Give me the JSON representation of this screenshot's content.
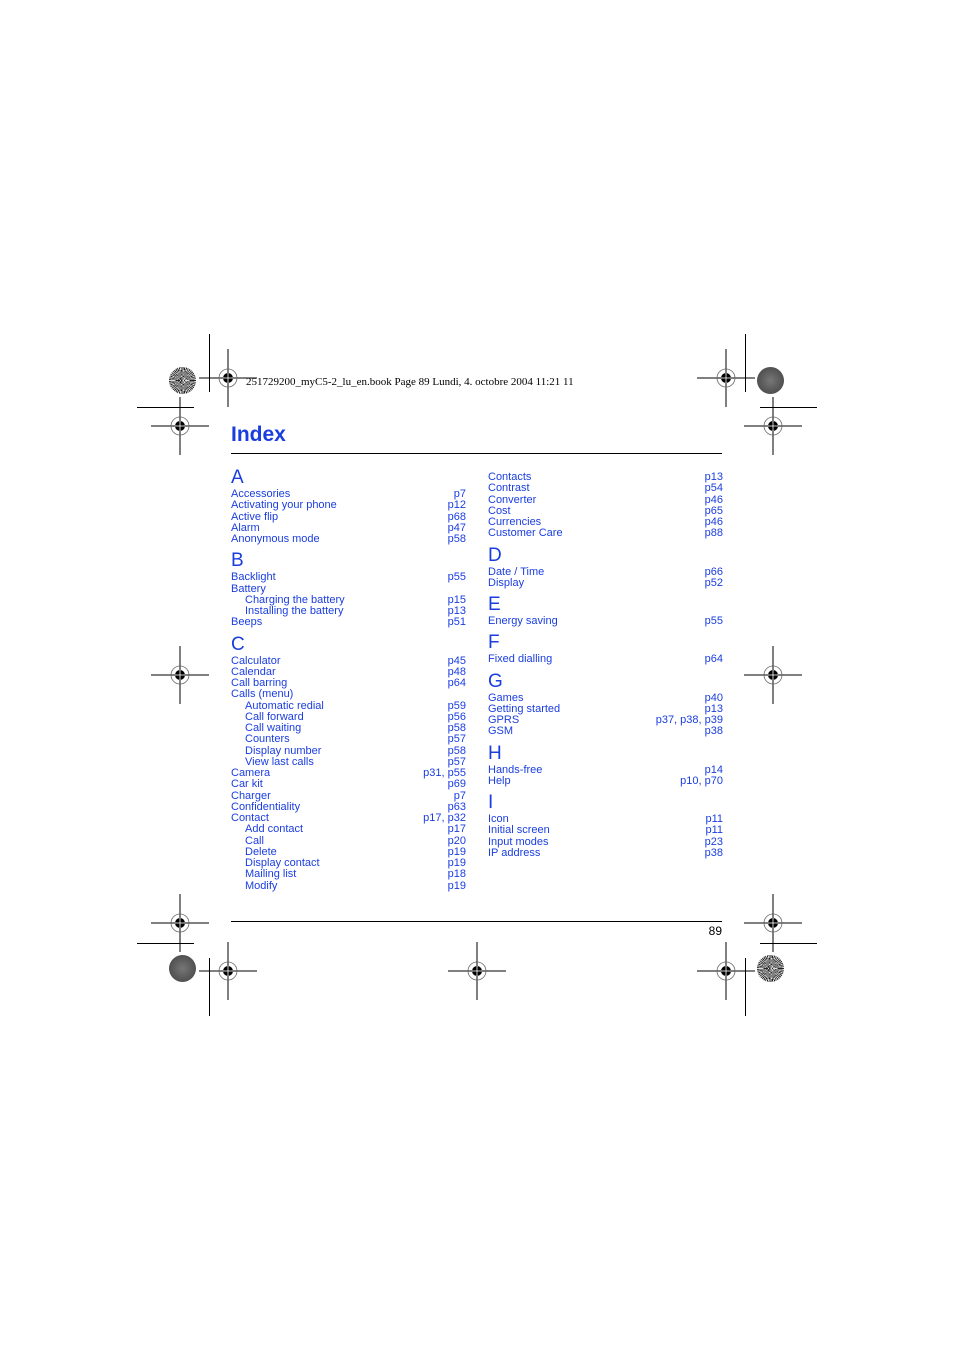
{
  "header": {
    "print_info": "251729200_myC5-2_lu_en.book  Page 89  Lundi, 4. octobre 2004  11:21 11"
  },
  "title": "Index",
  "page_number": "89",
  "colors": {
    "accent": "#1a3de0",
    "text": "#000000"
  },
  "left_column": [
    {
      "letter": "A",
      "entries": [
        {
          "term": "Accessories",
          "pages": "p7",
          "sub": false
        },
        {
          "term": "Activating your phone",
          "pages": "p12",
          "sub": false
        },
        {
          "term": "Active flip",
          "pages": "p68",
          "sub": false
        },
        {
          "term": "Alarm",
          "pages": "p47",
          "sub": false
        },
        {
          "term": "Anonymous mode",
          "pages": "p58",
          "sub": false
        }
      ]
    },
    {
      "letter": "B",
      "entries": [
        {
          "term": "Backlight",
          "pages": "p55",
          "sub": false
        },
        {
          "term": "Battery",
          "pages": "",
          "sub": false
        },
        {
          "term": "Charging the battery",
          "pages": "p15",
          "sub": true
        },
        {
          "term": "Installing the battery",
          "pages": "p13",
          "sub": true
        },
        {
          "term": "Beeps",
          "pages": "p51",
          "sub": false
        }
      ]
    },
    {
      "letter": "C",
      "entries": [
        {
          "term": "Calculator",
          "pages": "p45",
          "sub": false
        },
        {
          "term": "Calendar",
          "pages": "p48",
          "sub": false
        },
        {
          "term": "Call barring",
          "pages": "p64",
          "sub": false
        },
        {
          "term": "Calls (menu)",
          "pages": "",
          "sub": false
        },
        {
          "term": "Automatic redial",
          "pages": "p59",
          "sub": true
        },
        {
          "term": "Call forward",
          "pages": "p56",
          "sub": true
        },
        {
          "term": "Call waiting",
          "pages": "p58",
          "sub": true
        },
        {
          "term": "Counters",
          "pages": "p57",
          "sub": true
        },
        {
          "term": "Display number",
          "pages": "p58",
          "sub": true
        },
        {
          "term": "View last calls",
          "pages": "p57",
          "sub": true
        },
        {
          "term": "Camera",
          "pages": "p31, p55",
          "sub": false
        },
        {
          "term": "Car kit",
          "pages": "p69",
          "sub": false
        },
        {
          "term": "Charger",
          "pages": "p7",
          "sub": false
        },
        {
          "term": "Confidentiality",
          "pages": "p63",
          "sub": false
        },
        {
          "term": "Contact",
          "pages": "p17, p32",
          "sub": false
        },
        {
          "term": "Add contact",
          "pages": "p17",
          "sub": true
        },
        {
          "term": "Call",
          "pages": "p20",
          "sub": true
        },
        {
          "term": "Delete",
          "pages": "p19",
          "sub": true
        },
        {
          "term": "Display contact",
          "pages": "p19",
          "sub": true
        },
        {
          "term": "Mailing list",
          "pages": "p18",
          "sub": true
        },
        {
          "term": "Modify",
          "pages": "p19",
          "sub": true
        }
      ]
    }
  ],
  "right_column": [
    {
      "letter": "",
      "entries": [
        {
          "term": "Contacts",
          "pages": "p13",
          "sub": false
        },
        {
          "term": "Contrast",
          "pages": "p54",
          "sub": false
        },
        {
          "term": "Converter",
          "pages": "p46",
          "sub": false
        },
        {
          "term": "Cost",
          "pages": "p65",
          "sub": false
        },
        {
          "term": "Currencies",
          "pages": "p46",
          "sub": false
        },
        {
          "term": "Customer Care",
          "pages": "p88",
          "sub": false
        }
      ]
    },
    {
      "letter": "D",
      "entries": [
        {
          "term": "Date / Time",
          "pages": "p66",
          "sub": false
        },
        {
          "term": "Display",
          "pages": "p52",
          "sub": false
        }
      ]
    },
    {
      "letter": "E",
      "entries": [
        {
          "term": "Energy saving",
          "pages": "p55",
          "sub": false
        }
      ]
    },
    {
      "letter": "F",
      "entries": [
        {
          "term": "Fixed dialling",
          "pages": "p64",
          "sub": false
        }
      ]
    },
    {
      "letter": "G",
      "entries": [
        {
          "term": "Games",
          "pages": "p40",
          "sub": false
        },
        {
          "term": "Getting started",
          "pages": "p13",
          "sub": false
        },
        {
          "term": "GPRS",
          "pages": "p37, p38, p39",
          "sub": false
        },
        {
          "term": "GSM",
          "pages": "p38",
          "sub": false
        }
      ]
    },
    {
      "letter": "H",
      "entries": [
        {
          "term": "Hands-free",
          "pages": "p14",
          "sub": false
        },
        {
          "term": "Help",
          "pages": "p10, p70",
          "sub": false
        }
      ]
    },
    {
      "letter": "I",
      "entries": [
        {
          "term": "Icon",
          "pages": "p11",
          "sub": false
        },
        {
          "term": "Initial screen",
          "pages": "p11",
          "sub": false
        },
        {
          "term": "Input modes",
          "pages": "p23",
          "sub": false
        },
        {
          "term": "IP address",
          "pages": "p38",
          "sub": false
        }
      ]
    }
  ]
}
